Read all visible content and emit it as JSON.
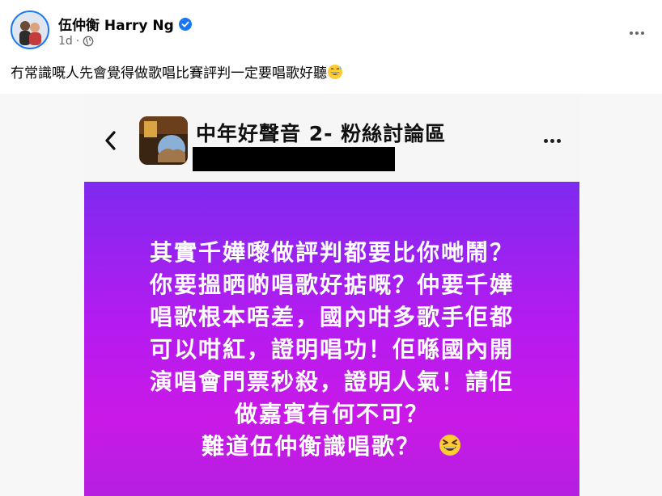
{
  "post": {
    "author": "伍仲衡 Harry Ng",
    "time": "1d",
    "caption": "冇常識嘅人先會覺得做歌唱比賽評判一定要唱歌好聽",
    "caption_emoji": "grinning-face-with-sweat-emoji",
    "verified_icon": "verified-badge-icon",
    "privacy_icon": "globe-icon"
  },
  "shared_screenshot": {
    "group_name": "中年好聲音 2- 粉絲討論區",
    "story_lines": [
      "其實千嬅嚟做評判都要比你哋鬧？",
      "你要搵晒啲唱歌好掂嘅？仲要千嬅",
      "唱歌根本唔差，國內咁多歌手佢都",
      "可以咁紅，證明唱功！佢喺國內開",
      "演唱會門票秒殺，證明人氣！請佢",
      "做嘉賓有何不可？",
      "難道伍仲衡識唱歌？"
    ],
    "story_emoji": "grinning-squinting-face-emoji",
    "gradient_top": "#7e2af0",
    "gradient_bottom": "#c919e7"
  },
  "colors": {
    "accent": "#1877f2",
    "meta_text": "#65676b"
  }
}
